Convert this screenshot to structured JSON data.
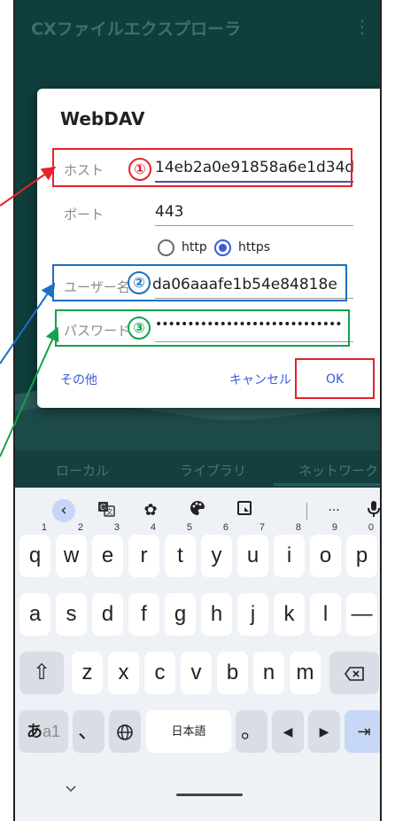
{
  "app": {
    "title": "CXファイルエクスプローラ",
    "menu_icon": "⋮",
    "tabs": [
      "ローカル",
      "ライブラリ",
      "ネットワーク"
    ]
  },
  "dialog": {
    "title": "WebDAV",
    "host": {
      "label": "ホスト",
      "value": "14eb2a0e91858a6e1d34d",
      "marker": "①"
    },
    "port": {
      "label": "ポート",
      "value": "443"
    },
    "protocol": {
      "options": [
        "http",
        "https"
      ],
      "selected": "https"
    },
    "user": {
      "label": "ユーザー名",
      "value": "da06aaafe1b54e84818e",
      "marker": "②"
    },
    "password": {
      "label": "パスワード",
      "value": "••••••••••••••••••••••••••••••••",
      "marker": "③"
    },
    "buttons": {
      "other": "その他",
      "cancel": "キャンセル",
      "ok": "OK"
    }
  },
  "colors": {
    "red": "#e8202a",
    "blue": "#1a6fc2",
    "green": "#12a24a",
    "accent": "#3b5bd9"
  },
  "keyboard": {
    "toolbar": [
      "back-icon",
      "translate-icon",
      "settings-icon",
      "palette-icon",
      "clipboard-icon",
      "more-icon",
      "mic-icon"
    ],
    "toolbar_more": "···",
    "row1": [
      "q",
      "w",
      "e",
      "r",
      "t",
      "y",
      "u",
      "i",
      "o",
      "p"
    ],
    "row1_hints": [
      "1",
      "2",
      "3",
      "4",
      "5",
      "6",
      "7",
      "8",
      "9",
      "0"
    ],
    "row2": [
      "a",
      "s",
      "d",
      "f",
      "g",
      "h",
      "j",
      "k",
      "l",
      "—"
    ],
    "row3": [
      "z",
      "x",
      "c",
      "v",
      "b",
      "n",
      "m"
    ],
    "row4": {
      "lang_switch": "あa1",
      "comma": "、",
      "jp": "日本語",
      "period": "。"
    }
  }
}
